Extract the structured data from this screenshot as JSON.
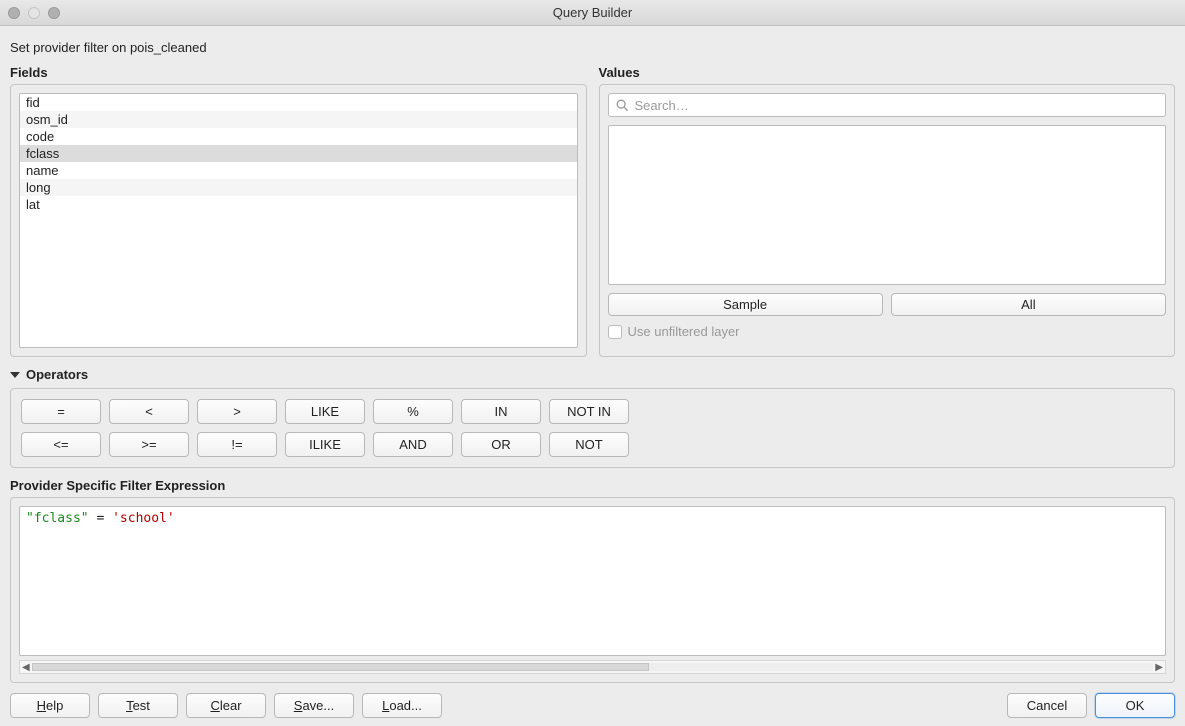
{
  "window": {
    "title": "Query Builder"
  },
  "subtitle": "Set provider filter on pois_cleaned",
  "fields": {
    "label": "Fields",
    "items": [
      "fid",
      "osm_id",
      "code",
      "fclass",
      "name",
      "long",
      "lat"
    ],
    "selected_index": 3
  },
  "values": {
    "label": "Values",
    "search_placeholder": "Search…",
    "sample_label": "Sample",
    "all_label": "All",
    "use_unfiltered_label": "Use unfiltered layer",
    "use_unfiltered_checked": false
  },
  "operators": {
    "label": "Operators",
    "row1": [
      "=",
      "<",
      ">",
      "LIKE",
      "%",
      "IN",
      "NOT IN"
    ],
    "row2": [
      "<=",
      ">=",
      "!=",
      "ILIKE",
      "AND",
      "OR",
      "NOT"
    ]
  },
  "expression": {
    "label": "Provider Specific Filter Expression",
    "tokens": [
      {
        "type": "field",
        "text": "\"fclass\""
      },
      {
        "type": "space",
        "text": " "
      },
      {
        "type": "op",
        "text": "="
      },
      {
        "type": "space",
        "text": " "
      },
      {
        "type": "str",
        "text": "'school'"
      }
    ]
  },
  "footer": {
    "help": "Help",
    "test": "Test",
    "clear": "Clear",
    "save": "Save...",
    "load": "Load...",
    "cancel": "Cancel",
    "ok": "OK"
  }
}
